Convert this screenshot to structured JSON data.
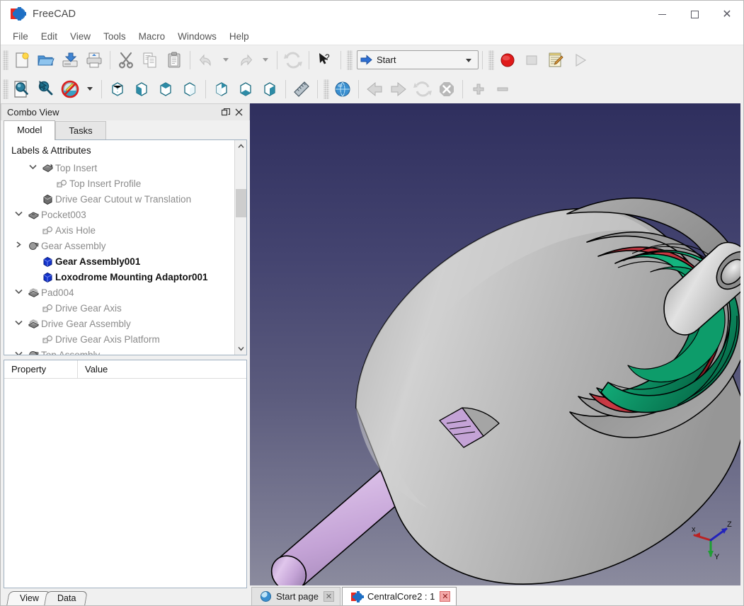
{
  "window": {
    "title": "FreeCAD",
    "app_icon": "freecad-logo-icon",
    "minimize": "—",
    "maximize": "□",
    "close": "✕"
  },
  "menu": {
    "items": [
      {
        "label": "File",
        "name": "menu-file"
      },
      {
        "label": "Edit",
        "name": "menu-edit"
      },
      {
        "label": "View",
        "name": "menu-view"
      },
      {
        "label": "Tools",
        "name": "menu-tools"
      },
      {
        "label": "Macro",
        "name": "menu-macro"
      },
      {
        "label": "Windows",
        "name": "menu-windows"
      },
      {
        "label": "Help",
        "name": "menu-help"
      }
    ]
  },
  "toolbar_file": {
    "buttons": [
      {
        "name": "new-document-button",
        "icon": "new-file-icon",
        "tooltip": "New",
        "enabled": true
      },
      {
        "name": "open-document-button",
        "icon": "open-folder-icon",
        "tooltip": "Open",
        "enabled": true
      },
      {
        "name": "save-document-button",
        "icon": "save-icon",
        "tooltip": "Save",
        "enabled": true
      },
      {
        "name": "print-button",
        "icon": "printer-icon",
        "tooltip": "Print",
        "enabled": true
      },
      {
        "name": "cut-button",
        "icon": "scissors-icon",
        "tooltip": "Cut",
        "enabled": true
      },
      {
        "name": "copy-button",
        "icon": "copy-icon",
        "tooltip": "Copy",
        "enabled": true
      },
      {
        "name": "paste-button",
        "icon": "clipboard-paste-icon",
        "tooltip": "Paste",
        "enabled": true
      },
      {
        "name": "undo-button",
        "icon": "undo-arrow-icon",
        "tooltip": "Undo",
        "enabled": false
      },
      {
        "name": "redo-button",
        "icon": "redo-arrow-icon",
        "tooltip": "Redo",
        "enabled": false
      },
      {
        "name": "refresh-button",
        "icon": "refresh-icon",
        "tooltip": "Refresh",
        "enabled": false
      },
      {
        "name": "whats-this-button",
        "icon": "whats-this-cursor-icon",
        "tooltip": "What's This",
        "enabled": true
      }
    ]
  },
  "workbench_selector": {
    "name": "workbench-selector",
    "value": "Start",
    "icon": "blue-arrow-icon",
    "caret": "chevron-down-icon"
  },
  "toolbar_macro": {
    "buttons": [
      {
        "name": "macro-record-button",
        "icon": "record-circle-icon",
        "enabled": true
      },
      {
        "name": "macro-stop-button",
        "icon": "stop-square-icon",
        "enabled": false
      },
      {
        "name": "macro-editor-button",
        "icon": "notepad-pencil-icon",
        "enabled": true
      },
      {
        "name": "macro-execute-button",
        "icon": "play-triangle-icon",
        "enabled": false
      }
    ]
  },
  "toolbar_view": {
    "buttons": [
      {
        "name": "fit-all-button",
        "icon": "zoom-fit-page-icon",
        "enabled": true
      },
      {
        "name": "fit-selection-button",
        "icon": "zoom-selection-icon",
        "enabled": true
      },
      {
        "name": "draw-style-button",
        "icon": "draw-style-no-shading-icon",
        "enabled": true
      },
      {
        "name": "axonometric-view-button",
        "icon": "cube-wireframe-icon",
        "enabled": true
      },
      {
        "name": "front-view-button",
        "icon": "cube-front-icon",
        "enabled": true
      },
      {
        "name": "top-view-button",
        "icon": "cube-top-icon",
        "enabled": true
      },
      {
        "name": "right-view-button",
        "icon": "cube-right-icon",
        "enabled": true
      },
      {
        "name": "rear-view-button",
        "icon": "cube-rear-icon",
        "enabled": true
      },
      {
        "name": "bottom-view-button",
        "icon": "cube-bottom-icon",
        "enabled": true
      },
      {
        "name": "left-view-button",
        "icon": "cube-left-icon",
        "enabled": true
      },
      {
        "name": "measure-button",
        "icon": "ruler-icon",
        "enabled": true
      }
    ]
  },
  "toolbar_web": {
    "buttons": [
      {
        "name": "browser-home-button",
        "icon": "globe-icon",
        "enabled": true
      },
      {
        "name": "browser-back-button",
        "icon": "arrow-left-icon",
        "enabled": false
      },
      {
        "name": "browser-forward-button",
        "icon": "arrow-right-icon",
        "enabled": false
      },
      {
        "name": "browser-reload-button",
        "icon": "reload-icon",
        "enabled": false
      },
      {
        "name": "browser-stop-button",
        "icon": "stop-octagon-icon",
        "enabled": false
      },
      {
        "name": "zoom-in-button",
        "icon": "plus-icon",
        "enabled": true
      },
      {
        "name": "zoom-out-button",
        "icon": "minus-icon",
        "enabled": true
      }
    ]
  },
  "combo_view": {
    "title": "Combo View",
    "float_icon": "restore-window-icon",
    "close_icon": "close-icon",
    "tabs": [
      {
        "label": "Model",
        "name": "tab-model",
        "active": true
      },
      {
        "label": "Tasks",
        "name": "tab-tasks",
        "active": false
      }
    ],
    "tree_header": "Labels & Attributes",
    "tree_items": [
      {
        "label": "Top Insert",
        "indent": 1,
        "arrow": "down",
        "icon": "pad-shape-icon",
        "bold": false
      },
      {
        "label": "Top Insert Profile",
        "indent": 2,
        "arrow": "none",
        "icon": "sketch-icon",
        "bold": false
      },
      {
        "label": "Drive Gear Cutout w Translation",
        "indent": 1,
        "arrow": "none",
        "icon": "box-gray-icon",
        "bold": false
      },
      {
        "label": "Pocket003",
        "indent": 0,
        "arrow": "down",
        "icon": "pocket-shape-icon",
        "bold": false
      },
      {
        "label": "Axis Hole",
        "indent": 1,
        "arrow": "none",
        "icon": "sketch-icon",
        "bold": false
      },
      {
        "label": "Gear Assembly",
        "indent": 0,
        "arrow": "right",
        "icon": "fusion-shape-icon",
        "bold": false
      },
      {
        "label": "Gear Assembly001",
        "indent": 1,
        "arrow": "none",
        "icon": "box-blue-icon",
        "bold": true
      },
      {
        "label": "Loxodrome Mounting Adaptor001",
        "indent": 1,
        "arrow": "none",
        "icon": "box-blue-icon",
        "bold": true
      },
      {
        "label": "Pad004",
        "indent": 0,
        "arrow": "down",
        "icon": "pad-layers-icon",
        "bold": false
      },
      {
        "label": "Drive Gear Axis",
        "indent": 1,
        "arrow": "none",
        "icon": "sketch-icon",
        "bold": false
      },
      {
        "label": "Drive Gear Assembly",
        "indent": 0,
        "arrow": "down",
        "icon": "pad-layers-icon",
        "bold": false
      },
      {
        "label": "Drive Gear Axis Platform",
        "indent": 1,
        "arrow": "none",
        "icon": "sketch-icon",
        "bold": false
      },
      {
        "label": "Top Assembly",
        "indent": 0,
        "arrow": "down",
        "icon": "fusion-shape-icon",
        "bold": false
      }
    ],
    "scroll_up_icon": "chevron-up-icon",
    "scroll_down_icon": "chevron-down-icon"
  },
  "property_editor": {
    "columns": [
      "Property",
      "Value"
    ],
    "rows": [],
    "tabs": [
      {
        "label": "View",
        "name": "tab-view",
        "active": true
      },
      {
        "label": "Data",
        "name": "tab-data",
        "active": false
      }
    ]
  },
  "viewport": {
    "background_top": "#2f2f5e",
    "background_bottom": "#8b8b9e",
    "axis_cross": {
      "x_label": "x",
      "y_label": "Y",
      "z_label": "Z",
      "x_color": "#cc2222",
      "y_color": "#22aa33",
      "z_color": "#2222cc"
    },
    "model_colors": {
      "body_gray": "#b8b8b8",
      "ring_red": "#b03038",
      "gear_green": "#0e9e6e",
      "shaft_lavender": "#c9a8d8",
      "outline": "#000000"
    }
  },
  "document_tabs": [
    {
      "label": "Start page",
      "name": "doc-tab-start-page",
      "icon": "globe-icon",
      "active": false,
      "close": "✕"
    },
    {
      "label": "CentralCore2 : 1",
      "name": "doc-tab-centralcore2",
      "icon": "freecad-logo-icon",
      "active": true,
      "close": "✕"
    }
  ]
}
